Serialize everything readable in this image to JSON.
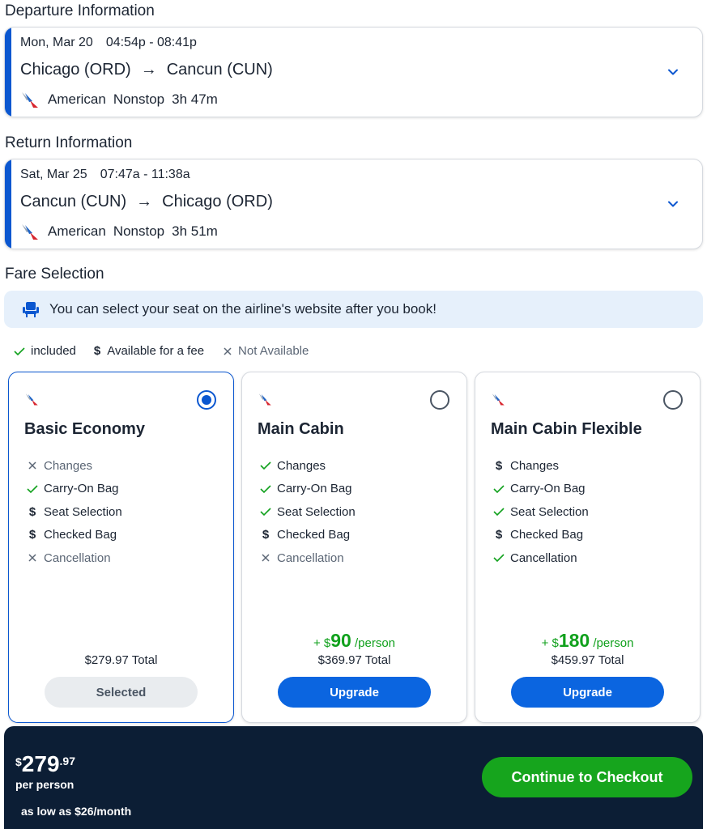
{
  "departure": {
    "section_title": "Departure Information",
    "date": "Mon, Mar 20",
    "time": "04:54p - 08:41p",
    "origin": "Chicago (ORD)",
    "destination": "Cancun (CUN)",
    "airline": "American",
    "stops": "Nonstop",
    "duration": "3h 47m"
  },
  "return": {
    "section_title": "Return Information",
    "date": "Sat, Mar 25",
    "time": "07:47a - 11:38a",
    "origin": "Cancun (CUN)",
    "destination": "Chicago (ORD)",
    "airline": "American",
    "stops": "Nonstop",
    "duration": "3h 51m"
  },
  "fare_selection": {
    "section_title": "Fare Selection",
    "notice": "You can select your seat on the airline's website after you book!",
    "legend": {
      "included": "included",
      "fee": "Available for a fee",
      "not_available": "Not Available"
    },
    "fares": [
      {
        "name": "Basic Economy",
        "selected": true,
        "features": [
          {
            "label": "Changes",
            "status": "none"
          },
          {
            "label": "Carry-On Bag",
            "status": "included"
          },
          {
            "label": "Seat Selection",
            "status": "fee"
          },
          {
            "label": "Checked Bag",
            "status": "fee"
          },
          {
            "label": "Cancellation",
            "status": "none"
          }
        ],
        "upgrade_prefix": "",
        "upgrade_amount": "",
        "upgrade_suffix": "",
        "total": "$279.97 Total",
        "button": "Selected"
      },
      {
        "name": "Main Cabin",
        "selected": false,
        "features": [
          {
            "label": "Changes",
            "status": "included"
          },
          {
            "label": "Carry-On Bag",
            "status": "included"
          },
          {
            "label": "Seat Selection",
            "status": "included"
          },
          {
            "label": "Checked Bag",
            "status": "fee"
          },
          {
            "label": "Cancellation",
            "status": "none"
          }
        ],
        "upgrade_prefix": "+ $",
        "upgrade_amount": "90",
        "upgrade_suffix": " /person",
        "total": "$369.97 Total",
        "button": "Upgrade"
      },
      {
        "name": "Main Cabin Flexible",
        "selected": false,
        "features": [
          {
            "label": "Changes",
            "status": "fee"
          },
          {
            "label": "Carry-On Bag",
            "status": "included"
          },
          {
            "label": "Seat Selection",
            "status": "included"
          },
          {
            "label": "Checked Bag",
            "status": "fee"
          },
          {
            "label": "Cancellation",
            "status": "included"
          }
        ],
        "upgrade_prefix": "+ $",
        "upgrade_amount": "180",
        "upgrade_suffix": " /person",
        "total": "$459.97 Total",
        "button": "Upgrade"
      }
    ]
  },
  "checkout": {
    "currency": "$",
    "dollars": "279",
    "cents": ".97",
    "per_person": "per person",
    "financing": "as low as $26/month",
    "button": "Continue to Checkout"
  },
  "colors": {
    "accent": "#0b57d0",
    "included": "#11a11d",
    "checkout_bg": "#0c1e35"
  }
}
